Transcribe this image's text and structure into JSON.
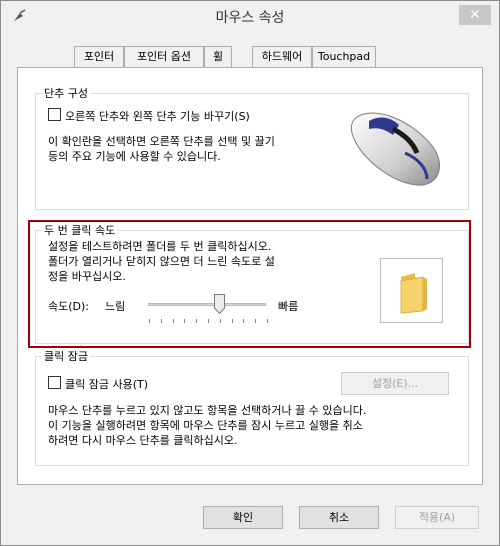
{
  "window": {
    "title": "마우스 속성",
    "close_glyph": "✕"
  },
  "tabs": [
    {
      "label": "포인터",
      "active": false
    },
    {
      "label": "포인터 옵션",
      "active": false
    },
    {
      "label": "휠",
      "active": false
    },
    {
      "label": "하드웨어",
      "active": false
    },
    {
      "label": "Touchpad",
      "active": false
    }
  ],
  "button_config": {
    "legend": "단추 구성",
    "swap_checkbox_label": "오른쪽 단추와 왼쪽 단추 기능 바꾸기(S)",
    "swap_checked": false,
    "description_line1": "이 확인란을 선택하면 오른쪽 단추를 선택 및 끌기",
    "description_line2": "등의 주요 기능에 사용할 수 있습니다."
  },
  "double_click": {
    "legend": "두 번 클릭 속도",
    "instruction_line1": "설정을 테스트하려면 폴더를 두 번 클릭하십시오.",
    "instruction_line2": "폴더가 열리거나 닫히지 않으면 더 느린 속도로 설",
    "instruction_line3": "정을 바꾸십시오.",
    "speed_label": "속도(D):",
    "slow_label": "느림",
    "fast_label": "빠름",
    "slider_value_fraction": 0.6
  },
  "click_lock": {
    "legend": "클릭 잠금",
    "checkbox_label": "클릭 잠금 사용(T)",
    "checked": false,
    "settings_button": "설정(E)...",
    "description_line1": "마우스 단추를 누르고 있지 않고도 항목을 선택하거나 끌 수 있습니다.",
    "description_line2": "이 기능을 실행하려면 항목에 마우스 단추를 잠시 누르고 실행을 취소",
    "description_line3": "하려면 다시 마우스 단추를 클릭하십시오."
  },
  "footer": {
    "ok": "확인",
    "cancel": "취소",
    "apply": "적용(A)"
  },
  "colors": {
    "highlight_border": "#a40000",
    "window_bg": "#f0f0f0",
    "panel_bg": "#ffffff",
    "folder": "#f6d26b"
  }
}
